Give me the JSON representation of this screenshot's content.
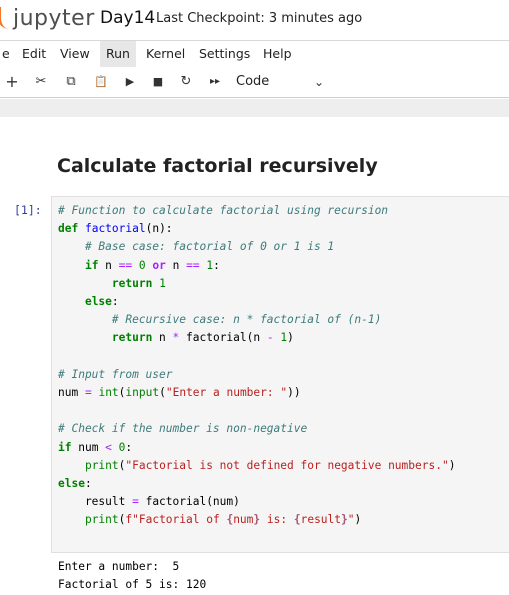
{
  "header": {
    "logo_text": "jupyter",
    "notebook_title": "Day14",
    "checkpoint_text": "Last Checkpoint: 3 minutes ago"
  },
  "menu": [
    "e",
    "Edit",
    "View",
    "Run",
    "Kernel",
    "Settings",
    "Help"
  ],
  "toolbar": {
    "add": "+",
    "cut": "✂",
    "copy": "⧉",
    "paste": "📋",
    "run": "▶",
    "stop": "■",
    "restart": "↻",
    "run_all": "▸▸",
    "cell_type": "Code",
    "cell_type_chevron": "⌄"
  },
  "markdown_heading": "Calculate factorial recursively",
  "code_cell": {
    "prompt": "[1]:",
    "lines": [
      "# Function to calculate factorial using recursion",
      "def factorial(n):",
      "    # Base case: factorial of 0 or 1 is 1",
      "    if n == 0 or n == 1:",
      "        return 1",
      "    else:",
      "        # Recursive case: n * factorial of (n-1)",
      "        return n * factorial(n - 1)",
      "",
      "# Input from user",
      "num = int(input(\"Enter a number: \"))",
      "",
      "# Check if the number is non-negative",
      "if num < 0:",
      "    print(\"Factorial is not defined for negative numbers.\")",
      "else:",
      "    result = factorial(num)",
      "    print(f\"Factorial of {num} is: {result}\")"
    ]
  },
  "output": {
    "lines": [
      "Enter a number:  5",
      "Factorial of 5 is: 120"
    ]
  },
  "colors": {
    "accent_orange": "#f37726",
    "prompt_blue": "#303f9f",
    "comment": "#3d7b7b",
    "keyword": "#008000",
    "string": "#ba2121",
    "function": "#0000ff"
  }
}
